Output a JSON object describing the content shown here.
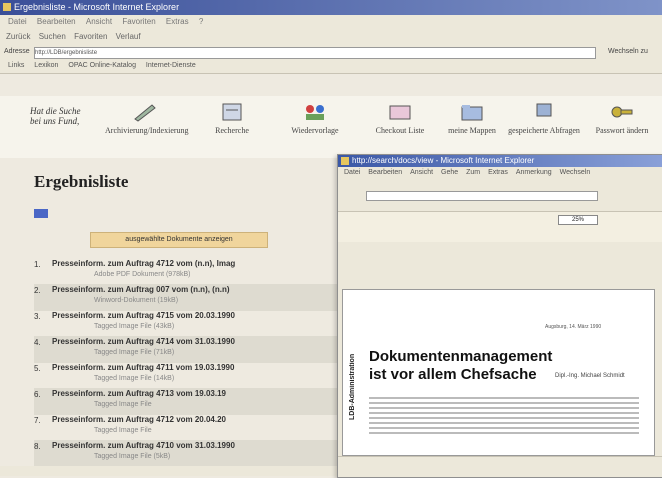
{
  "window": {
    "title": "Ergebnisliste - Microsoft Internet Explorer"
  },
  "menu": {
    "items": [
      "Datei",
      "Bearbeiten",
      "Ansicht",
      "Favoriten",
      "Extras",
      "?"
    ]
  },
  "toolbar": {
    "back": "Zurück",
    "search": "Suchen",
    "favorites": "Favoriten",
    "history": "Verlauf"
  },
  "address": {
    "label": "Adresse",
    "value": "http://LDB/ergebnisliste",
    "go": "Wechseln zu"
  },
  "links": {
    "items": [
      "Links",
      "Lexikon",
      "OPAC Online-Katalog",
      "Internet-Dienste"
    ]
  },
  "nav": {
    "logo_line1": "Hat die Suche",
    "logo_line2": "bei uns Fund,",
    "items": [
      "Archivierung/Indexierung",
      "Recherche",
      "Wiedervorlage",
      "Checkout Liste",
      "meine Mappen",
      "gespeicherte Abfragen",
      "Passwort ändern"
    ]
  },
  "main": {
    "heading": "Ergebnisliste",
    "show_button": "ausgewählte Dokumente anzeigen",
    "results": [
      {
        "num": "1.",
        "title": "Presseinform. zum Auftrag 4712 vom (n.n), Imag",
        "sub": "Adobe PDF Dokument (978kB)"
      },
      {
        "num": "2.",
        "title": "Presseinform. zum Auftrag 007 vom (n.n), (n.n)",
        "sub": "Winword-Dokument (19kB)"
      },
      {
        "num": "3.",
        "title": "Presseinform. zum Auftrag 4715 vom 20.03.1990",
        "sub": "Tagged Image File (43kB)"
      },
      {
        "num": "4.",
        "title": "Presseinform. zum Auftrag 4714 vom 31.03.1990",
        "sub": "Tagged Image File (71kB)"
      },
      {
        "num": "5.",
        "title": "Presseinform. zum Auftrag 4711 vom 19.03.1990",
        "sub": "Tagged Image File (14kB)"
      },
      {
        "num": "6.",
        "title": "Presseinform. zum Auftrag 4713 vom 19.03.19",
        "sub": "Tagged Image File"
      },
      {
        "num": "7.",
        "title": "Presseinform. zum Auftrag 4712 vom 20.04.20",
        "sub": "Tagged Image File"
      },
      {
        "num": "8.",
        "title": "Presseinform. zum Auftrag 4710 vom 31.03.1990",
        "sub": "Tagged Image File (5kB)"
      }
    ]
  },
  "popup": {
    "title": "http://search/docs/view - Microsoft Internet Explorer",
    "menu": [
      "Datei",
      "Bearbeiten",
      "Ansicht",
      "Gehe",
      "Zum",
      "Extras",
      "Anmerkung",
      "Wechseln"
    ],
    "zoom": "25%",
    "doc": {
      "vertical": "LDB-Administration",
      "date": "Augsburg, 14. März 1990",
      "headline1": "Dokumentenmanagement",
      "headline2": "ist vor allem Chefsache",
      "author": "Dipl.-Ing. Michael Schmidt"
    }
  }
}
